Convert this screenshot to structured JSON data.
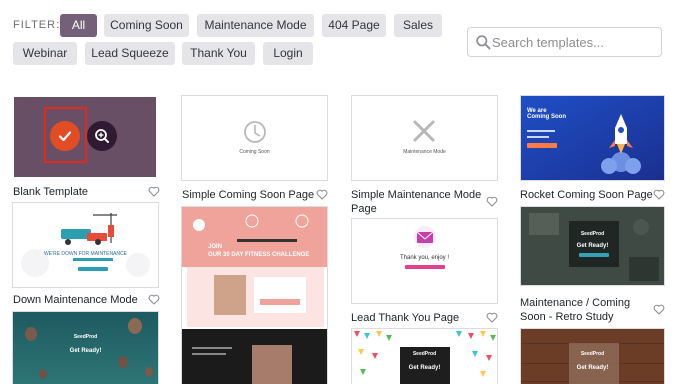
{
  "filter": {
    "label": "FILTER:",
    "chips": [
      "All",
      "Coming Soon",
      "Maintenance Mode",
      "404 Page",
      "Sales",
      "Webinar",
      "Lead Squeeze",
      "Thank You",
      "Login"
    ]
  },
  "search": {
    "placeholder": "Search templates..."
  },
  "templates": [
    {
      "title": "Blank Template"
    },
    {
      "title": "Simple Coming Soon Page",
      "preview_text": "Coming Soon"
    },
    {
      "title": "Simple Maintenance Mode Page",
      "preview_text": "Maintenance Mode"
    },
    {
      "title": "Rocket Coming Soon Page",
      "preview_text": "We are Coming Soon"
    },
    {
      "title": "Down Maintenance Mode",
      "preview_text": "WE'RE DOWN FOR MAINTENANCE"
    },
    {
      "title": "Lead Thank You Page",
      "preview_text": "Thank you, enjoy !"
    },
    {
      "title": "Maintenance / Coming Soon - Retro Study",
      "preview_text": "Get Ready!",
      "brand": "SeedProd"
    },
    {
      "title": "",
      "preview_text": "Get Ready!",
      "brand": "SeedProd"
    },
    {
      "title": "",
      "preview_lines": [
        "JOIN",
        "OUR 30 DAY FITNESS CHALLENGE"
      ]
    },
    {
      "title": "",
      "preview_text": "Get Ready!",
      "brand": "SeedProd"
    },
    {
      "title": "",
      "preview_text": "Get Ready!",
      "brand": "SeedProd"
    }
  ],
  "colors": {
    "accent": "#75607a",
    "chip": "#e5e4e8",
    "check": "#e24d26"
  }
}
